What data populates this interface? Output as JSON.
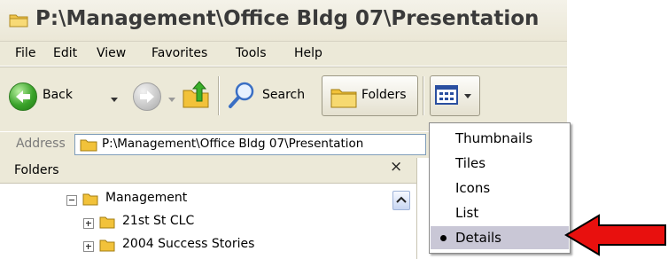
{
  "window": {
    "title": "P:\\Management\\Office Bldg 07\\Presentation"
  },
  "menubar": {
    "items": [
      "File",
      "Edit",
      "View",
      "Favorites",
      "Tools",
      "Help"
    ]
  },
  "toolbar": {
    "back_label": "Back",
    "search_label": "Search",
    "folders_label": "Folders"
  },
  "address": {
    "label": "Address",
    "value": "P:\\Management\\Office Bldg 07\\Presentation"
  },
  "folders_pane": {
    "title": "Folders",
    "close_glyph": "×",
    "tree": [
      {
        "label": "Management",
        "expander": "minus"
      },
      {
        "label": "21st St CLC",
        "expander": "plus"
      },
      {
        "label": "2004 Success Stories",
        "expander": "plus"
      }
    ]
  },
  "views_menu": {
    "items": [
      "Thumbnails",
      "Tiles",
      "Icons",
      "List",
      "Details"
    ],
    "selected": "Details"
  },
  "colors": {
    "arrow": "#e8100e",
    "arrow_outline": "#000000",
    "menu_highlight": "#c9c7d6",
    "folder_yellow": "#f5c83a",
    "back_green": "#3aa32a"
  }
}
